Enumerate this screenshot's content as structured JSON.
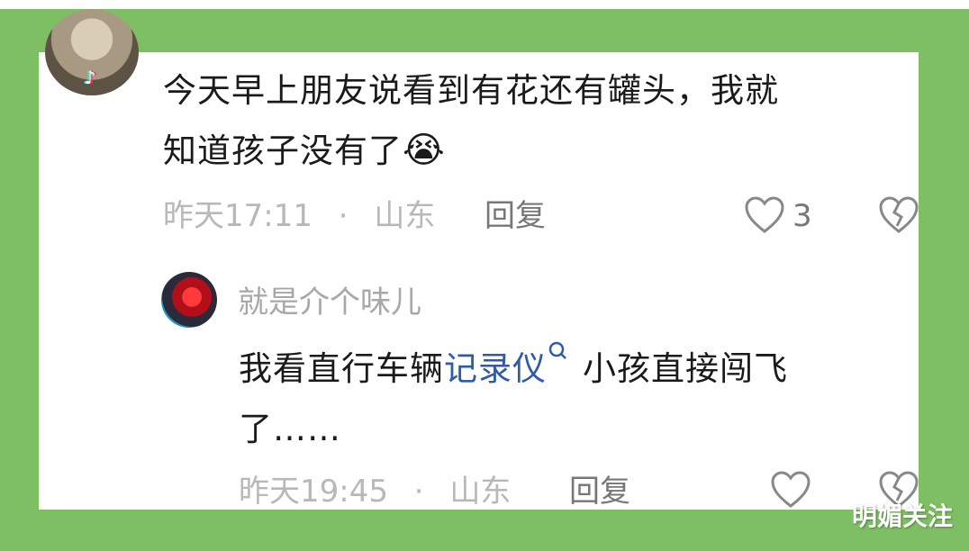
{
  "comment1": {
    "text_line1": "今天早上朋友说看到有花还有罐头，我就",
    "text_line2": "知道孩子没有了",
    "emoji": "😭",
    "time": "昨天17:11",
    "separator": "·",
    "location": "山东",
    "reply_label": "回复",
    "like_count": "3"
  },
  "comment2": {
    "username": "就是介个味儿",
    "text_part1": "我看直行车辆",
    "link_text": "记录仪",
    "text_part2": "小孩直接闯飞",
    "text_line2": "了……",
    "time": "昨天19:45",
    "separator": "·",
    "location": "山东",
    "reply_label": "回复"
  },
  "watermark": "明媚关注",
  "colors": {
    "frame_green": "#7fbf63",
    "link_blue": "#2f5aa8",
    "meta_gray": "#b8b8b8"
  }
}
